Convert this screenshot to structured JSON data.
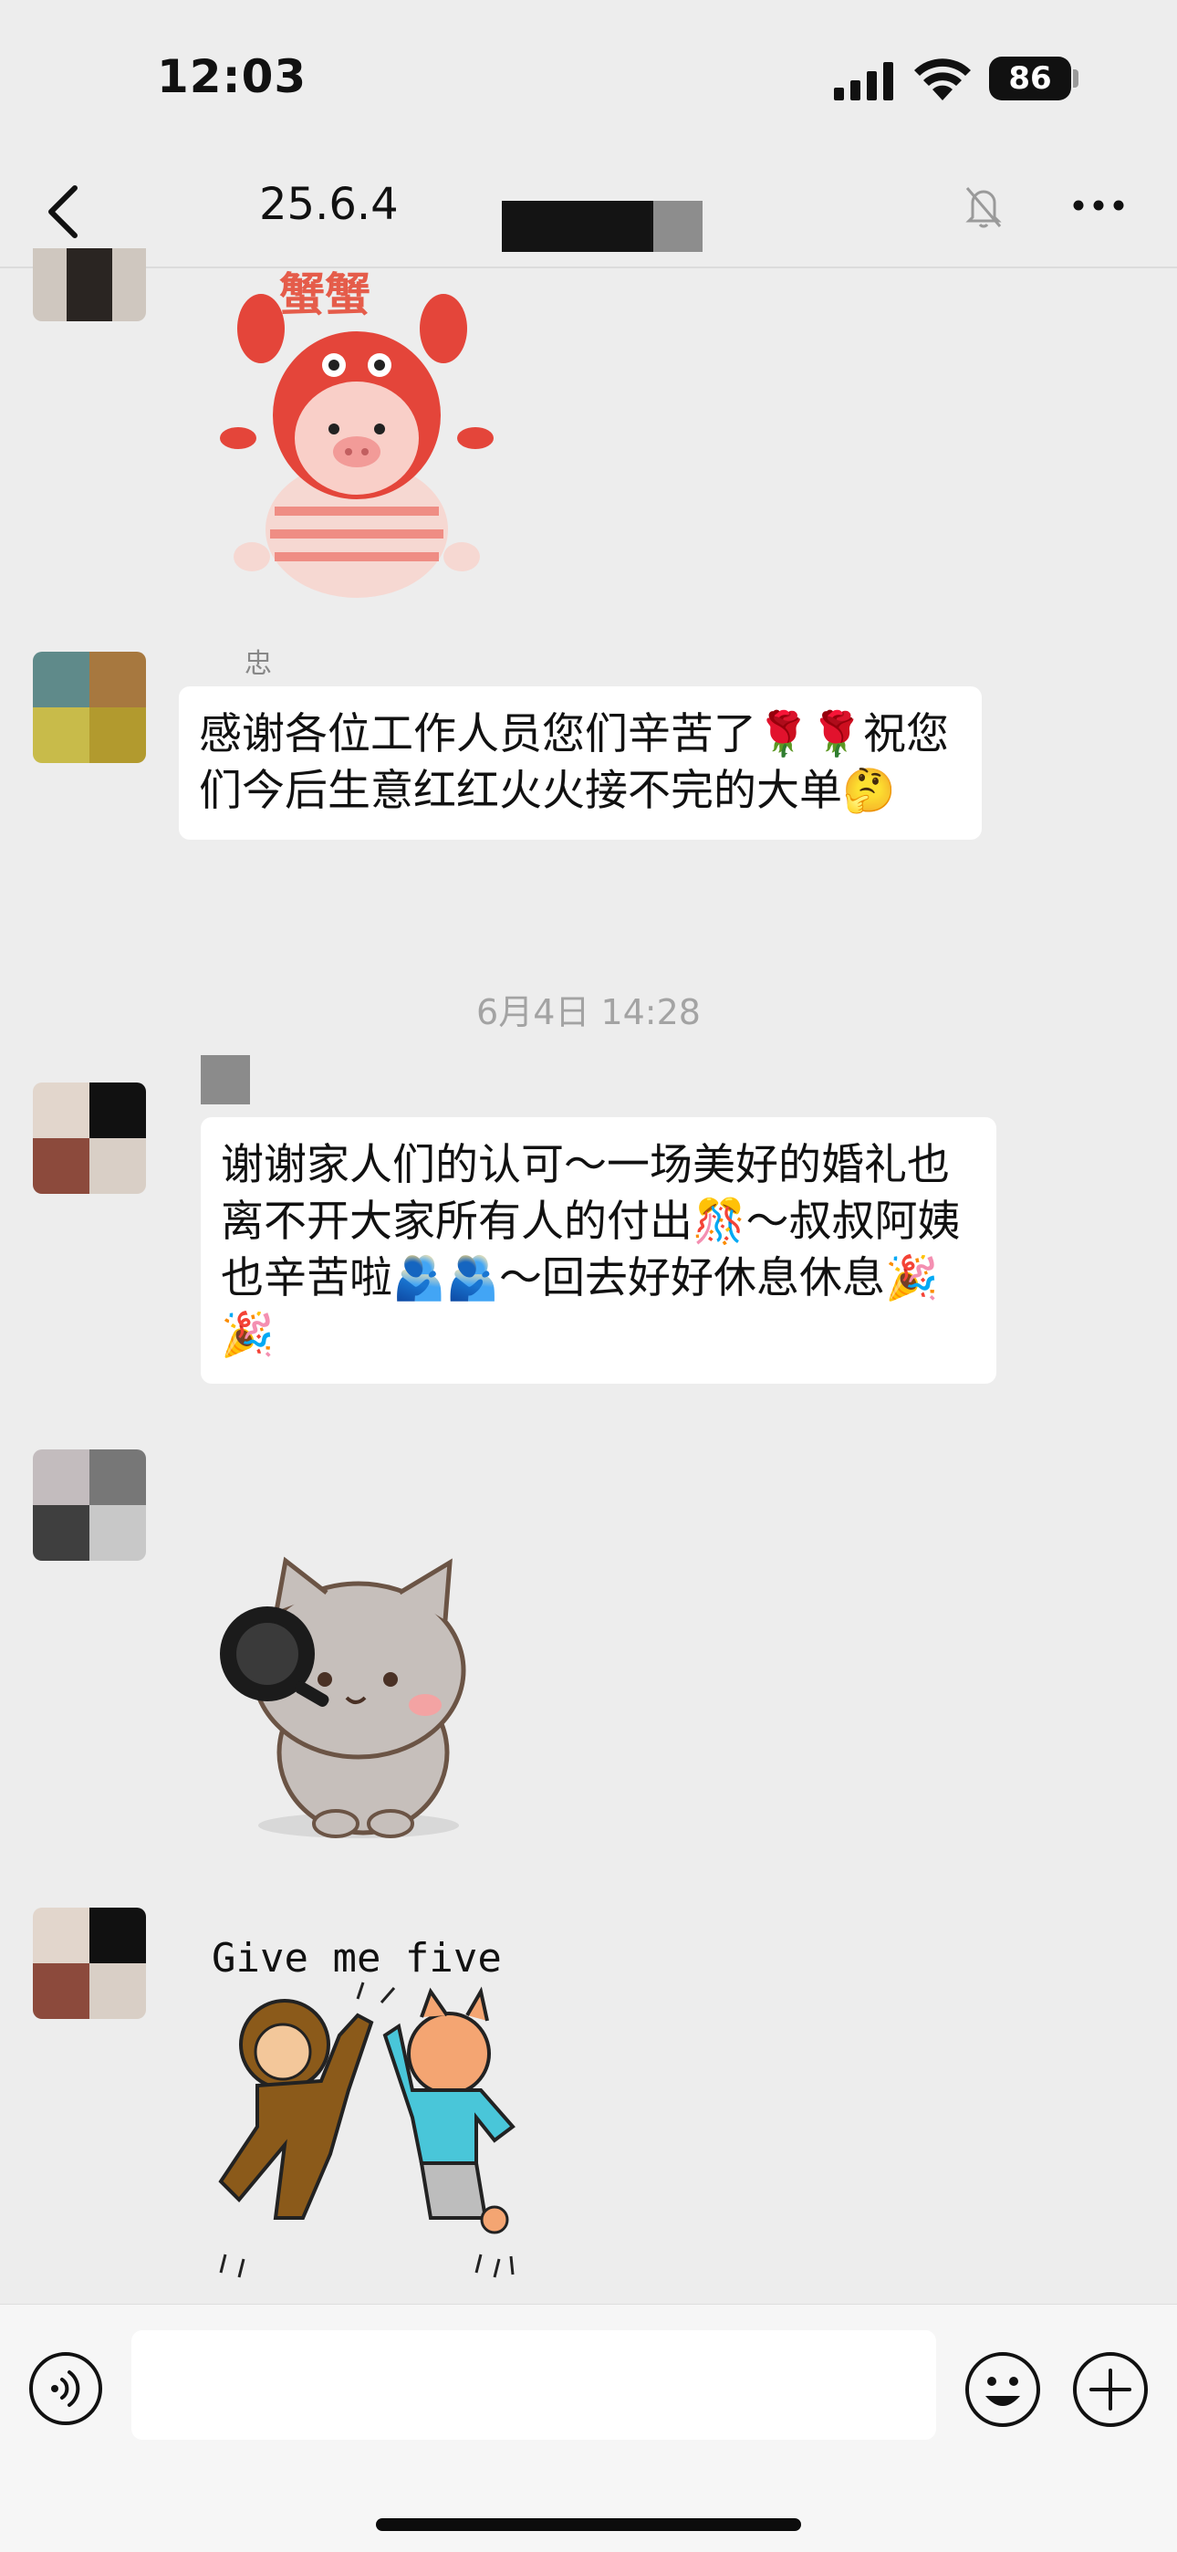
{
  "status_bar": {
    "time": "12:03",
    "battery": "86"
  },
  "nav": {
    "title": "25.6.4"
  },
  "messages": [
    {
      "sender": "忠",
      "text": "感谢各位工作人员您们辛苦了🌹🌹祝您们今后生意红红火火接不完的大单🤔"
    },
    {
      "timestamp": "6月4日 14:28"
    },
    {
      "text": "谢谢家人们的认可～一场美好的婚礼也离不开大家所有人的付出🎊～叔叔阿姨也辛苦啦🫂🫂～回去好好休息休息🎉🎉"
    },
    {
      "sticker_text": "Give me five"
    }
  ],
  "icons": {
    "back": "chevron-left-icon",
    "mute": "bell-slash-icon",
    "more": "ellipsis-icon",
    "voice": "voice-icon",
    "emoji": "smiley-icon",
    "plus": "plus-icon"
  }
}
